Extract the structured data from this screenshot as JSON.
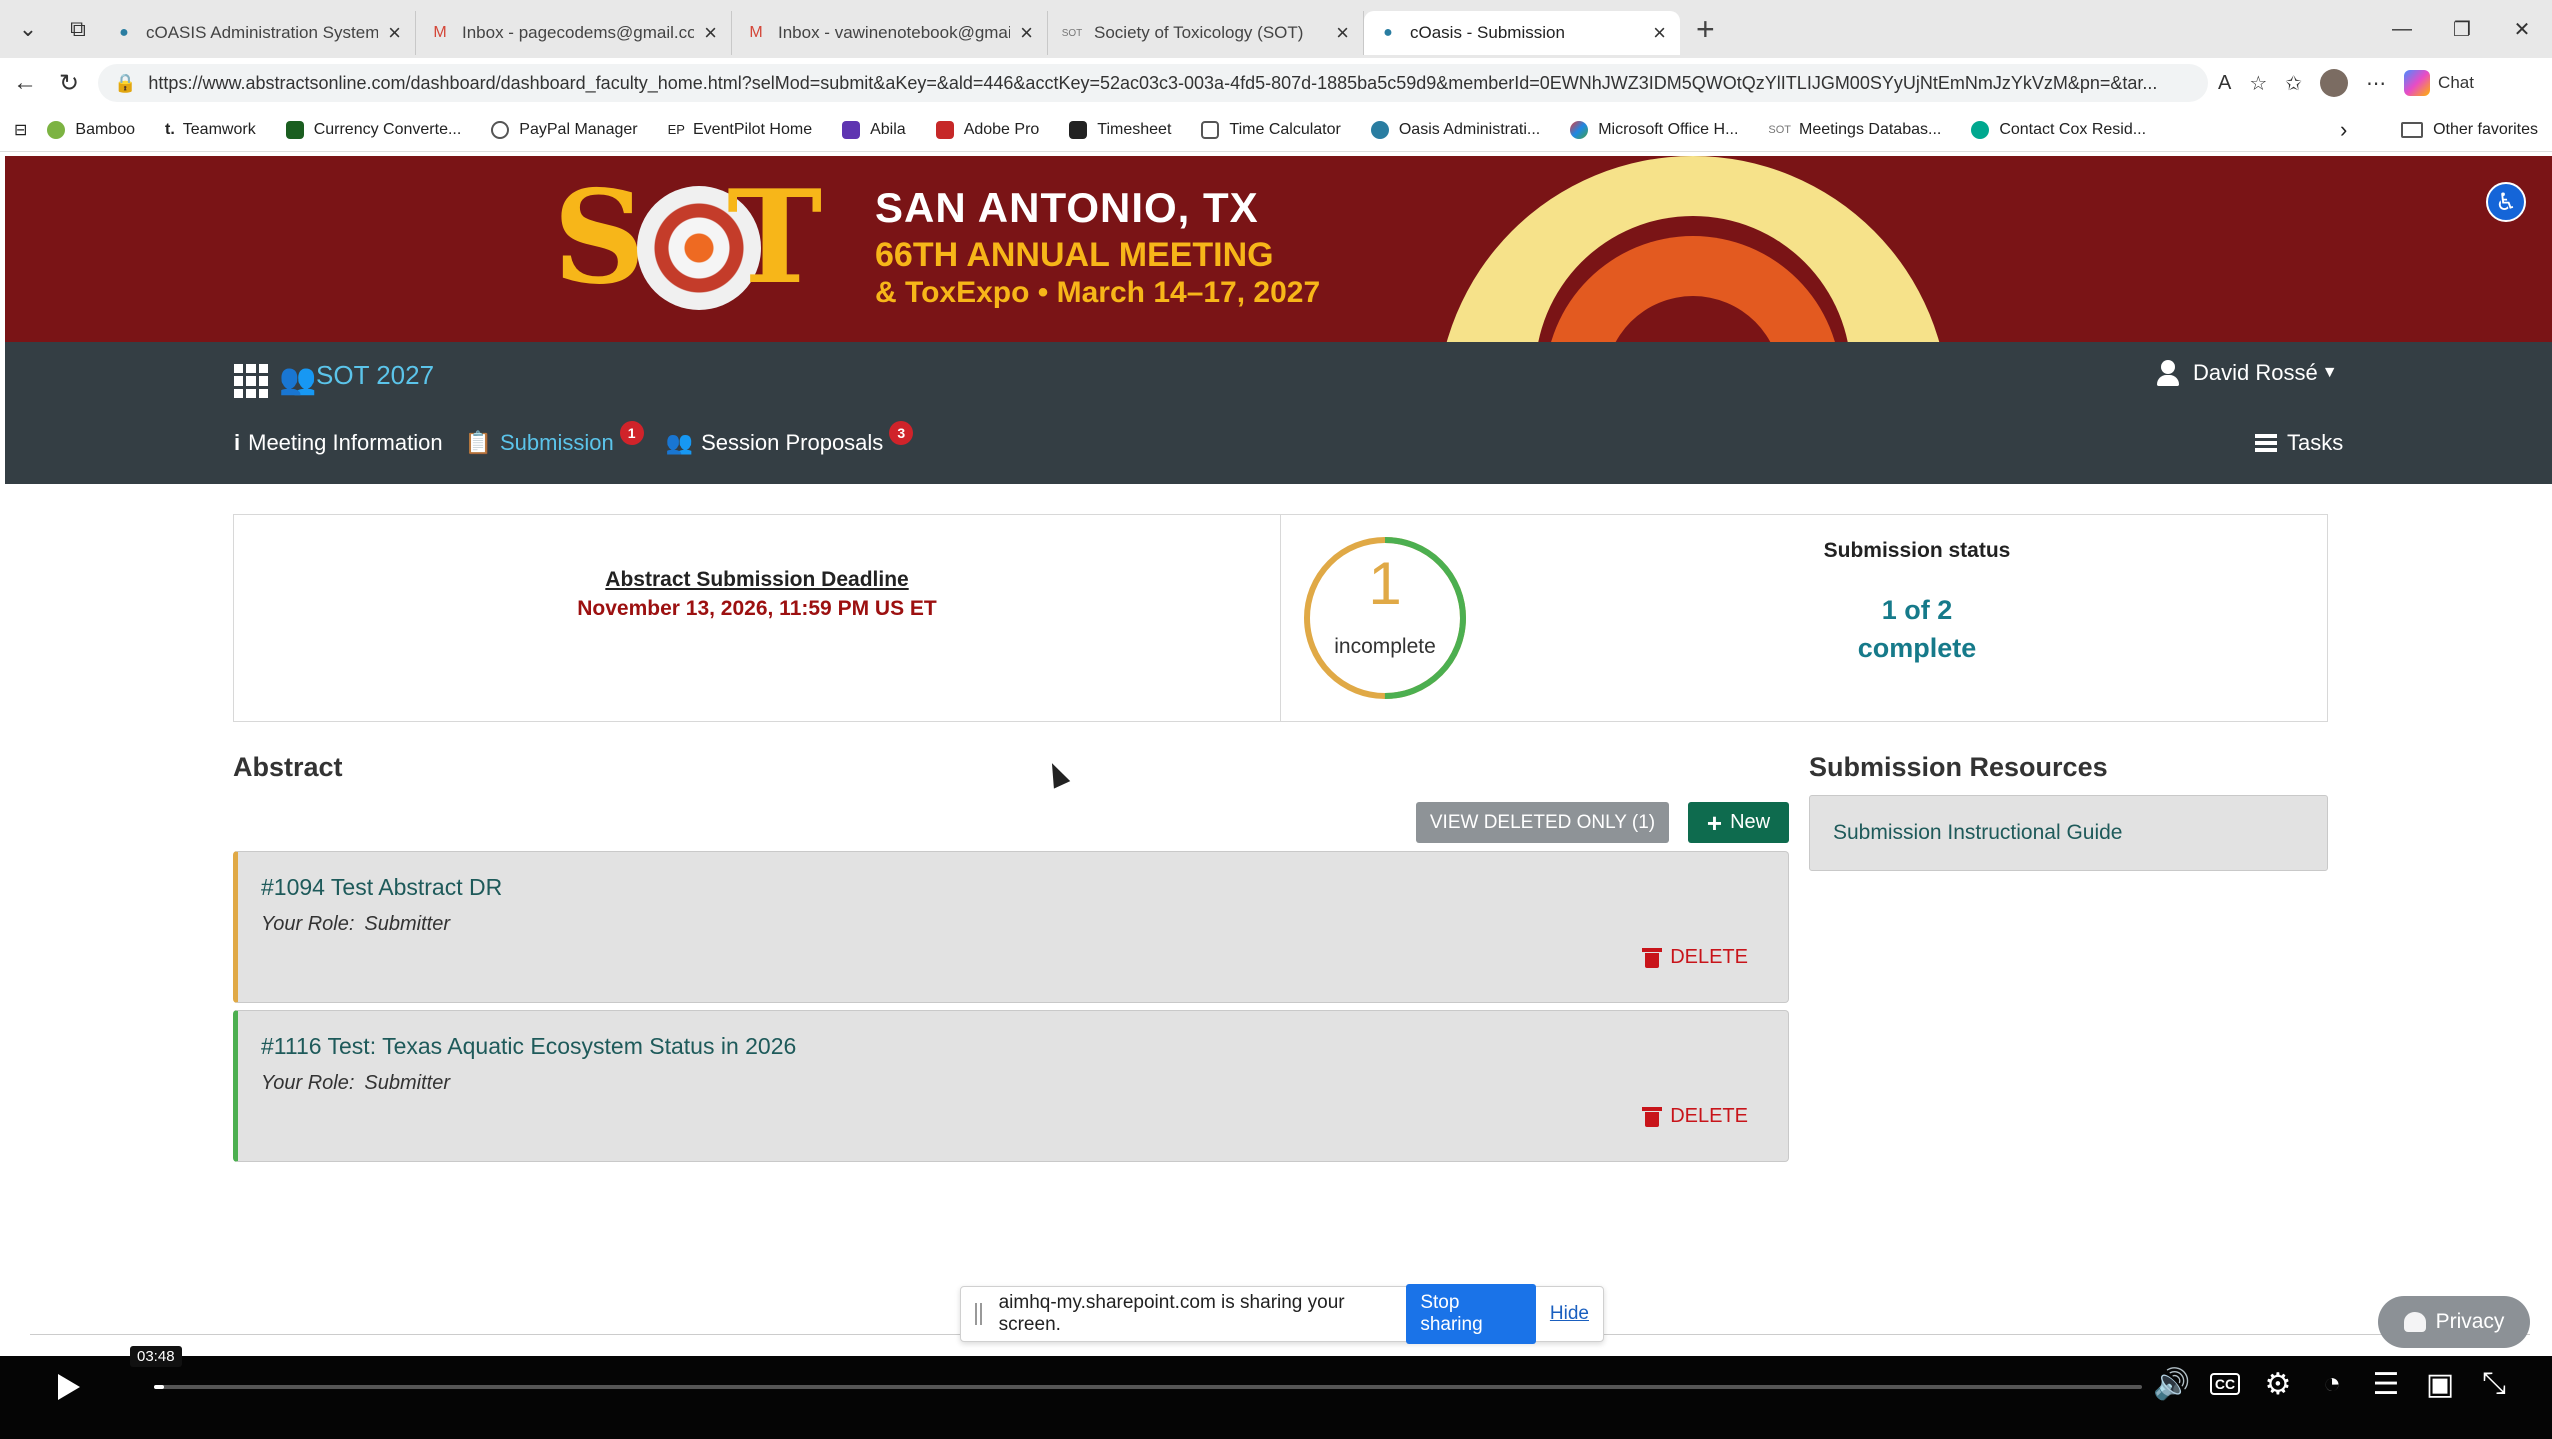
{
  "browser": {
    "tabs": [
      {
        "title": "cOASIS Administration System",
        "icon": "coasis-icon"
      },
      {
        "title": "Inbox - pagecodems@gmail.com",
        "icon": "gmail-icon"
      },
      {
        "title": "Inbox - vawinenotebook@gmail.co",
        "icon": "gmail-icon"
      },
      {
        "title": "Society of Toxicology (SOT)",
        "icon": "sot-icon"
      },
      {
        "title": "cOasis - Submission",
        "icon": "coasis-icon",
        "active": true
      }
    ],
    "url": "https://www.abstractsonline.com/dashboard/dashboard_faculty_home.html?selMod=submit&aKey=&ald=446&acctKey=52ac03c3-003a-4fd5-807d-1885ba5c59d9&memberId=0EWNhJWZ3IDM5QWOtQzYlITLIJGM00SYyUjNtEmNmJzYkVzM&pn=&tar...",
    "chat_label": "Chat",
    "bookmarks": [
      "Bamboo",
      "Teamwork",
      "Currency Converte...",
      "PayPal Manager",
      "EventPilot Home",
      "Abila",
      "Adobe Pro",
      "Timesheet",
      "Time Calculator",
      "Oasis Administrati...",
      "Microsoft Office H...",
      "Meetings Databas...",
      "Contact Cox Resid..."
    ],
    "bookmark_prefixes": [
      "",
      "t.",
      "",
      "",
      "EP",
      "",
      "",
      "",
      "",
      "",
      "",
      "SOT",
      ""
    ],
    "other_favorites": "Other favorites"
  },
  "banner": {
    "logo_s": "S",
    "logo_t": "T",
    "city": "SAN ANTONIO, TX",
    "annual": "66TH ANNUAL MEETING",
    "dates": "& ToxExpo • March 14–17, 2027"
  },
  "appnav": {
    "meeting": "SOT 2027",
    "user": "David Rossé",
    "items": [
      {
        "label": "Meeting Information",
        "badge": null
      },
      {
        "label": "Submission",
        "badge": "1"
      },
      {
        "label": "Session Proposals",
        "badge": "3"
      }
    ],
    "tasks": "Tasks"
  },
  "status": {
    "deadline_title": "Abstract Submission Deadline",
    "deadline_date": "November 13, 2026, 11:59 PM US ET",
    "ring_count": "1",
    "ring_label": "incomplete",
    "ring_complete_fraction": 0.5,
    "title": "Submission status",
    "value_line1": "1 of 2",
    "value_line2": "complete",
    "colors": {
      "incomplete": "#e0a946",
      "complete": "#4caf50"
    }
  },
  "abstracts": {
    "heading": "Abstract",
    "view_deleted": "VIEW DELETED ONLY (1)",
    "new_label": "New",
    "role_label": "Your Role:",
    "delete_label": "DELETE",
    "items": [
      {
        "title": "#1094 Test Abstract DR",
        "role": "Submitter",
        "status": "incomplete"
      },
      {
        "title": "#1116 Test: Texas Aquatic Ecosystem Status in 2026",
        "role": "Submitter",
        "status": "complete"
      }
    ]
  },
  "resources": {
    "heading": "Submission Resources",
    "link": "Submission Instructional Guide"
  },
  "share": {
    "message": "aimhq-my.sharepoint.com is sharing your screen.",
    "stop": "Stop sharing",
    "hide": "Hide"
  },
  "privacy": "Privacy",
  "video": {
    "time": "03:48",
    "progress": 0.005
  }
}
